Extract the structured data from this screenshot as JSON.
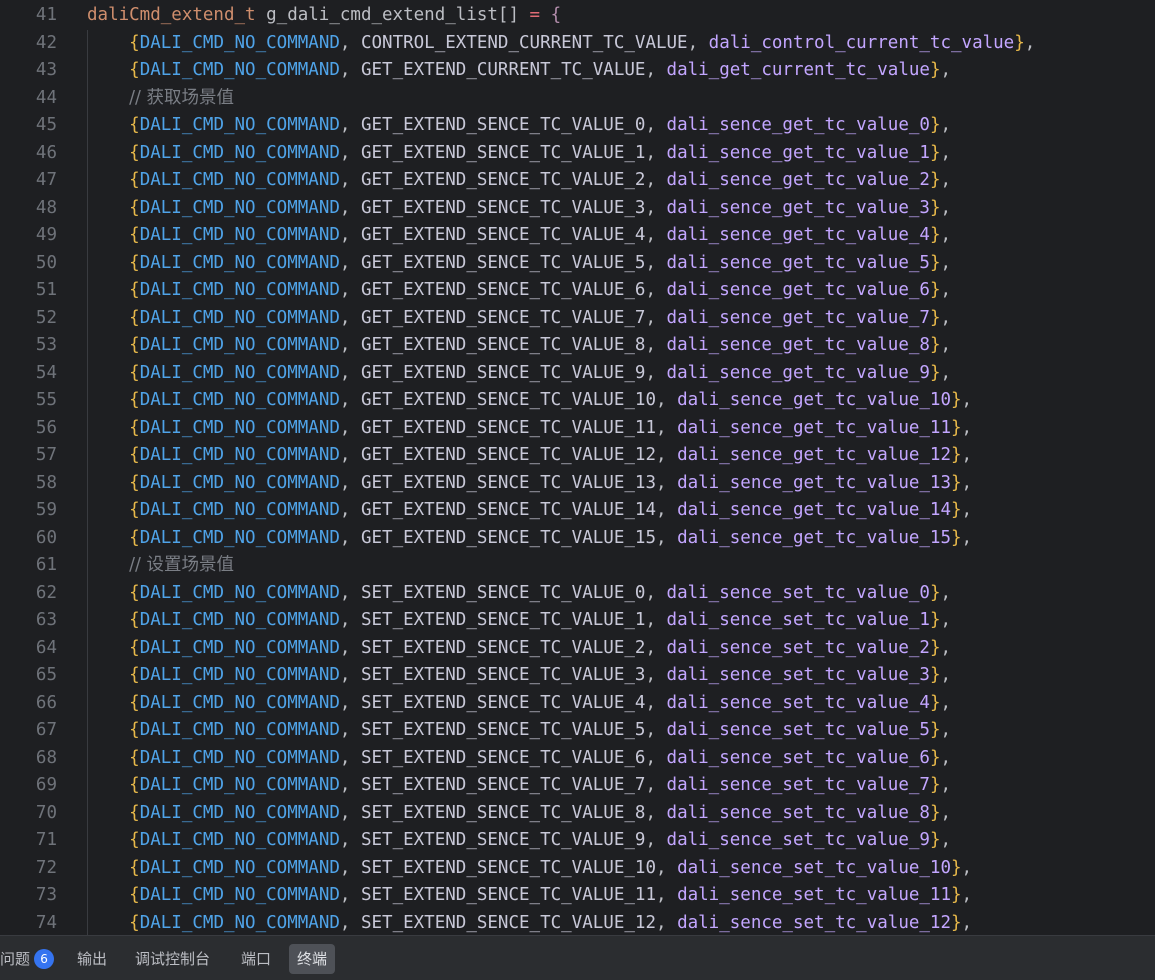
{
  "editor": {
    "lines": [
      {
        "n": "41",
        "kind": "decl",
        "type": "daliCmd_extend_t",
        "name": "g_dali_cmd_extend_list[]",
        "assign": "="
      },
      {
        "n": "42",
        "kind": "entry",
        "c": "DALI_CMD_NO_COMMAND",
        "m": "CONTROL_EXTEND_CURRENT_TC_VALUE",
        "f": "dali_control_current_tc_value"
      },
      {
        "n": "43",
        "kind": "entry",
        "c": "DALI_CMD_NO_COMMAND",
        "m": "GET_EXTEND_CURRENT_TC_VALUE",
        "f": "dali_get_current_tc_value"
      },
      {
        "n": "44",
        "kind": "comment",
        "text": "// 获取场景值"
      },
      {
        "n": "45",
        "kind": "entry",
        "c": "DALI_CMD_NO_COMMAND",
        "m": "GET_EXTEND_SENCE_TC_VALUE_0",
        "f": "dali_sence_get_tc_value_0"
      },
      {
        "n": "46",
        "kind": "entry",
        "c": "DALI_CMD_NO_COMMAND",
        "m": "GET_EXTEND_SENCE_TC_VALUE_1",
        "f": "dali_sence_get_tc_value_1"
      },
      {
        "n": "47",
        "kind": "entry",
        "c": "DALI_CMD_NO_COMMAND",
        "m": "GET_EXTEND_SENCE_TC_VALUE_2",
        "f": "dali_sence_get_tc_value_2"
      },
      {
        "n": "48",
        "kind": "entry",
        "c": "DALI_CMD_NO_COMMAND",
        "m": "GET_EXTEND_SENCE_TC_VALUE_3",
        "f": "dali_sence_get_tc_value_3"
      },
      {
        "n": "49",
        "kind": "entry",
        "c": "DALI_CMD_NO_COMMAND",
        "m": "GET_EXTEND_SENCE_TC_VALUE_4",
        "f": "dali_sence_get_tc_value_4"
      },
      {
        "n": "50",
        "kind": "entry",
        "c": "DALI_CMD_NO_COMMAND",
        "m": "GET_EXTEND_SENCE_TC_VALUE_5",
        "f": "dali_sence_get_tc_value_5"
      },
      {
        "n": "51",
        "kind": "entry",
        "c": "DALI_CMD_NO_COMMAND",
        "m": "GET_EXTEND_SENCE_TC_VALUE_6",
        "f": "dali_sence_get_tc_value_6"
      },
      {
        "n": "52",
        "kind": "entry",
        "c": "DALI_CMD_NO_COMMAND",
        "m": "GET_EXTEND_SENCE_TC_VALUE_7",
        "f": "dali_sence_get_tc_value_7"
      },
      {
        "n": "53",
        "kind": "entry",
        "c": "DALI_CMD_NO_COMMAND",
        "m": "GET_EXTEND_SENCE_TC_VALUE_8",
        "f": "dali_sence_get_tc_value_8"
      },
      {
        "n": "54",
        "kind": "entry",
        "c": "DALI_CMD_NO_COMMAND",
        "m": "GET_EXTEND_SENCE_TC_VALUE_9",
        "f": "dali_sence_get_tc_value_9"
      },
      {
        "n": "55",
        "kind": "entry",
        "c": "DALI_CMD_NO_COMMAND",
        "m": "GET_EXTEND_SENCE_TC_VALUE_10",
        "f": "dali_sence_get_tc_value_10"
      },
      {
        "n": "56",
        "kind": "entry",
        "c": "DALI_CMD_NO_COMMAND",
        "m": "GET_EXTEND_SENCE_TC_VALUE_11",
        "f": "dali_sence_get_tc_value_11"
      },
      {
        "n": "57",
        "kind": "entry",
        "c": "DALI_CMD_NO_COMMAND",
        "m": "GET_EXTEND_SENCE_TC_VALUE_12",
        "f": "dali_sence_get_tc_value_12"
      },
      {
        "n": "58",
        "kind": "entry",
        "c": "DALI_CMD_NO_COMMAND",
        "m": "GET_EXTEND_SENCE_TC_VALUE_13",
        "f": "dali_sence_get_tc_value_13"
      },
      {
        "n": "59",
        "kind": "entry",
        "c": "DALI_CMD_NO_COMMAND",
        "m": "GET_EXTEND_SENCE_TC_VALUE_14",
        "f": "dali_sence_get_tc_value_14"
      },
      {
        "n": "60",
        "kind": "entry",
        "c": "DALI_CMD_NO_COMMAND",
        "m": "GET_EXTEND_SENCE_TC_VALUE_15",
        "f": "dali_sence_get_tc_value_15"
      },
      {
        "n": "61",
        "kind": "comment",
        "text": "// 设置场景值"
      },
      {
        "n": "62",
        "kind": "entry",
        "c": "DALI_CMD_NO_COMMAND",
        "m": "SET_EXTEND_SENCE_TC_VALUE_0",
        "f": "dali_sence_set_tc_value_0"
      },
      {
        "n": "63",
        "kind": "entry",
        "c": "DALI_CMD_NO_COMMAND",
        "m": "SET_EXTEND_SENCE_TC_VALUE_1",
        "f": "dali_sence_set_tc_value_1"
      },
      {
        "n": "64",
        "kind": "entry",
        "c": "DALI_CMD_NO_COMMAND",
        "m": "SET_EXTEND_SENCE_TC_VALUE_2",
        "f": "dali_sence_set_tc_value_2"
      },
      {
        "n": "65",
        "kind": "entry",
        "c": "DALI_CMD_NO_COMMAND",
        "m": "SET_EXTEND_SENCE_TC_VALUE_3",
        "f": "dali_sence_set_tc_value_3"
      },
      {
        "n": "66",
        "kind": "entry",
        "c": "DALI_CMD_NO_COMMAND",
        "m": "SET_EXTEND_SENCE_TC_VALUE_4",
        "f": "dali_sence_set_tc_value_4"
      },
      {
        "n": "67",
        "kind": "entry",
        "c": "DALI_CMD_NO_COMMAND",
        "m": "SET_EXTEND_SENCE_TC_VALUE_5",
        "f": "dali_sence_set_tc_value_5"
      },
      {
        "n": "68",
        "kind": "entry",
        "c": "DALI_CMD_NO_COMMAND",
        "m": "SET_EXTEND_SENCE_TC_VALUE_6",
        "f": "dali_sence_set_tc_value_6"
      },
      {
        "n": "69",
        "kind": "entry",
        "c": "DALI_CMD_NO_COMMAND",
        "m": "SET_EXTEND_SENCE_TC_VALUE_7",
        "f": "dali_sence_set_tc_value_7"
      },
      {
        "n": "70",
        "kind": "entry",
        "c": "DALI_CMD_NO_COMMAND",
        "m": "SET_EXTEND_SENCE_TC_VALUE_8",
        "f": "dali_sence_set_tc_value_8"
      },
      {
        "n": "71",
        "kind": "entry",
        "c": "DALI_CMD_NO_COMMAND",
        "m": "SET_EXTEND_SENCE_TC_VALUE_9",
        "f": "dali_sence_set_tc_value_9"
      },
      {
        "n": "72",
        "kind": "entry",
        "c": "DALI_CMD_NO_COMMAND",
        "m": "SET_EXTEND_SENCE_TC_VALUE_10",
        "f": "dali_sence_set_tc_value_10"
      },
      {
        "n": "73",
        "kind": "entry",
        "c": "DALI_CMD_NO_COMMAND",
        "m": "SET_EXTEND_SENCE_TC_VALUE_11",
        "f": "dali_sence_set_tc_value_11"
      },
      {
        "n": "74",
        "kind": "entry",
        "c": "DALI_CMD_NO_COMMAND",
        "m": "SET_EXTEND_SENCE_TC_VALUE_12",
        "f": "dali_sence_set_tc_value_12"
      }
    ],
    "syntax_colors": {
      "background": "#1e1f22",
      "type": "#cf8e6d",
      "constant": "#4fa3e8",
      "function": "#c3a6ff",
      "comment": "#7a7e85",
      "line_number": "#6f737a"
    }
  },
  "panel": {
    "tabs": [
      {
        "label": "问题",
        "badge": "6",
        "active": false
      },
      {
        "label": "输出",
        "active": false
      },
      {
        "label": "调试控制台",
        "active": false
      },
      {
        "label": "端口",
        "active": false
      },
      {
        "label": "终端",
        "active": true
      }
    ],
    "accent_color": "#3574f0"
  }
}
